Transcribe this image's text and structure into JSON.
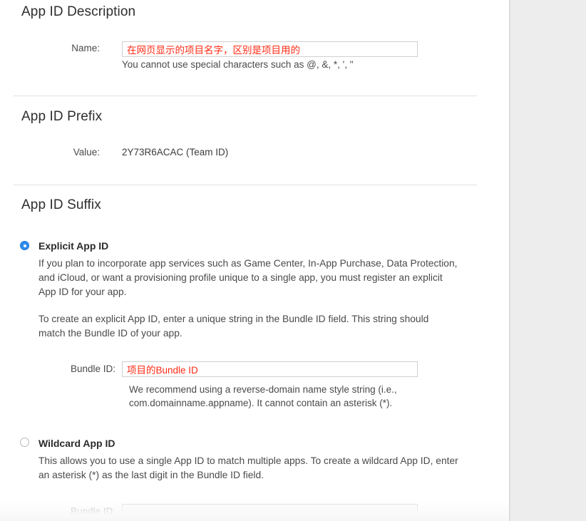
{
  "theme": {
    "accent": "#2e8bee",
    "annotation_color": "#ff2a13",
    "body_text": "#4a4a4a",
    "panel_bg": "#ffffff",
    "gutter_bg": "#ededed"
  },
  "sections": {
    "description": {
      "title": "App ID Description",
      "name_label": "Name:",
      "name_value": "在网页显示的项目名字，区别是项目用的",
      "name_placeholder": "",
      "name_helper": "You cannot use special characters such as @, &, *, ', \""
    },
    "prefix": {
      "title": "App ID Prefix",
      "value_label": "Value:",
      "value_text": "2Y73R6ACAC (Team ID)"
    },
    "suffix": {
      "title": "App ID Suffix",
      "explicit": {
        "radio_state": "selected",
        "title": "Explicit App ID",
        "paragraph_1": "If you plan to incorporate app services such as Game Center, In-App Purchase, Data Protection, and iCloud, or want a provisioning profile unique to a single app, you must register an explicit App ID for your app.",
        "paragraph_2": "To create an explicit App ID, enter a unique string in the Bundle ID field. This string should match the Bundle ID of your app.",
        "bundle_label": "Bundle ID:",
        "bundle_value": "项目的Bundle ID",
        "bundle_placeholder": "",
        "bundle_helper": "We recommend using a reverse-domain name style string (i.e., com.domainname.appname). It cannot contain an asterisk (*)."
      },
      "wildcard": {
        "radio_state": "unselected",
        "title": "Wildcard App ID",
        "paragraph_1": "This allows you to use a single App ID to match multiple apps. To create a wildcard App ID, enter an asterisk (*) as the last digit in the Bundle ID field.",
        "bundle_label": "Bundle ID:",
        "bundle_value": "",
        "bundle_placeholder": ""
      }
    }
  }
}
